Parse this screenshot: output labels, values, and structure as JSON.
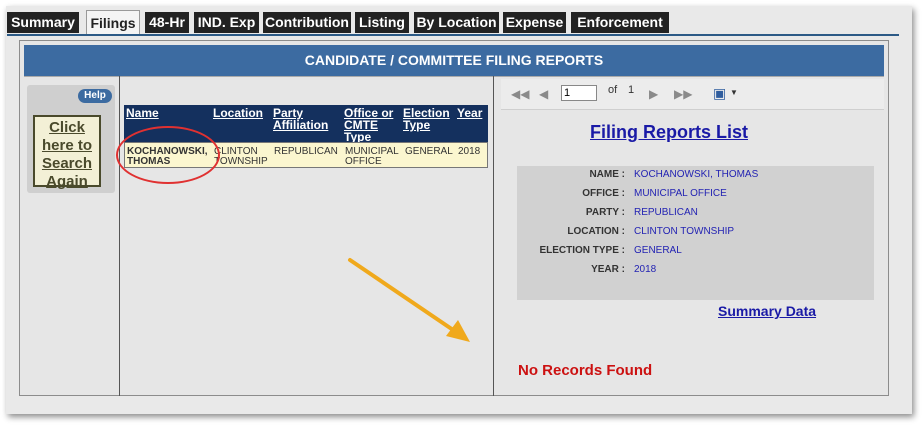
{
  "tabs": [
    "Summary",
    "Filings",
    "48-Hr",
    "IND. Exp",
    "Contribution",
    "Listing",
    "By Location",
    "Expense",
    "Enforcement"
  ],
  "active_tab": "Filings",
  "banner": "CANDIDATE / COMMITTEE FILING REPORTS",
  "left": {
    "help": "Help",
    "search_again": "Click here to Search Again"
  },
  "results": {
    "headers": {
      "name": "Name",
      "location": "Location",
      "party": "Party Affiliation",
      "office": "Office or CMTE Type",
      "election": "Election Type",
      "year": "Year"
    },
    "row": {
      "name": "KOCHANOWSKI, THOMAS",
      "location": "CLINTON TOWNSHIP",
      "party": "REPUBLICAN",
      "office": "MUNICIPAL OFFICE",
      "election": "GENERAL",
      "year": "2018"
    }
  },
  "viewer": {
    "page": "1",
    "of_label": "of",
    "total_pages": "1"
  },
  "report": {
    "title": "Filing Reports List",
    "fields": [
      {
        "label": "NAME :",
        "value": "KOCHANOWSKI, THOMAS"
      },
      {
        "label": "OFFICE :",
        "value": "MUNICIPAL OFFICE"
      },
      {
        "label": "PARTY :",
        "value": "REPUBLICAN"
      },
      {
        "label": "LOCATION :",
        "value": "CLINTON TOWNSHIP"
      },
      {
        "label": "ELECTION TYPE :",
        "value": "GENERAL"
      },
      {
        "label": "YEAR :",
        "value": "2018"
      }
    ],
    "summary_link": "Summary Data",
    "no_records": "No Records Found"
  },
  "colors": {
    "banner": "#3c6ba1",
    "table_header": "#14305e",
    "row_highlight": "#fbf6cf",
    "link": "#1a1aa6",
    "alert": "#cc1111",
    "annotation_circle": "#e03131",
    "annotation_arrow": "#f0a91c"
  }
}
